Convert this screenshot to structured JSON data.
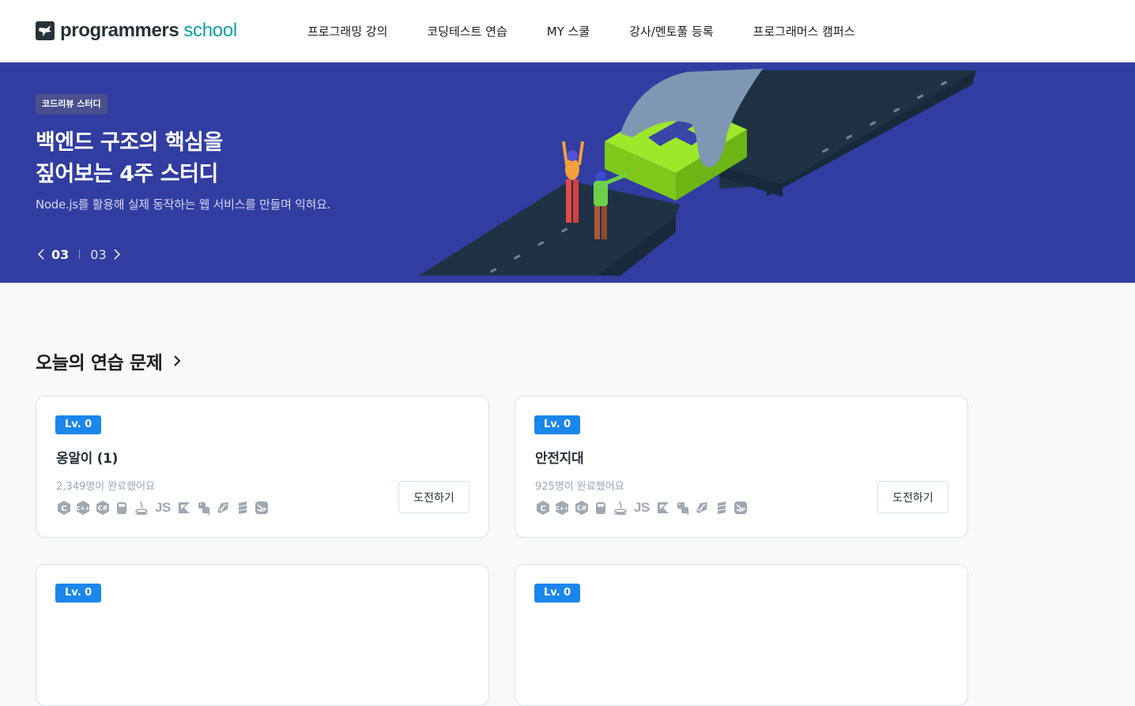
{
  "header": {
    "logo": {
      "brand": "programmers",
      "suffix": "school"
    },
    "nav": [
      {
        "label": "프로그래밍 강의"
      },
      {
        "label": "코딩테스트 연습"
      },
      {
        "label": "MY 스쿨"
      },
      {
        "label": "강사/멘토풀 등록"
      },
      {
        "label": "프로그래머스 캠퍼스"
      }
    ]
  },
  "banner": {
    "badge": "코드리뷰 스터디",
    "title_line1": "백엔드 구조의 핵심을",
    "title_line2": "짚어보는 4주 스터디",
    "subtitle": "Node.js를 활용해 실제 동작하는 웹 서비스를 만들며 익혀요.",
    "pager": {
      "current": "03",
      "total": "03"
    }
  },
  "section": {
    "title": "오늘의 연습 문제"
  },
  "cards": [
    {
      "level": "Lv. 0",
      "title": "옹알이 (1)",
      "completed": "2,349명이 완료했어요",
      "button": "도전하기"
    },
    {
      "level": "Lv. 0",
      "title": "안전지대",
      "completed": "925명이 완료했어요",
      "button": "도전하기"
    },
    {
      "level": "Lv. 0"
    },
    {
      "level": "Lv. 0"
    }
  ],
  "language_icons": [
    "c-icon",
    "cpp-icon",
    "csharp-icon",
    "go-icon",
    "java-icon",
    "javascript-icon",
    "kotlin-icon",
    "python3-icon",
    "ruby-icon",
    "scala-icon",
    "swift-icon"
  ],
  "colors": {
    "banner_bg": "#313da0",
    "level_badge": "#1b86ec",
    "school_text": "#0aa0a0"
  }
}
